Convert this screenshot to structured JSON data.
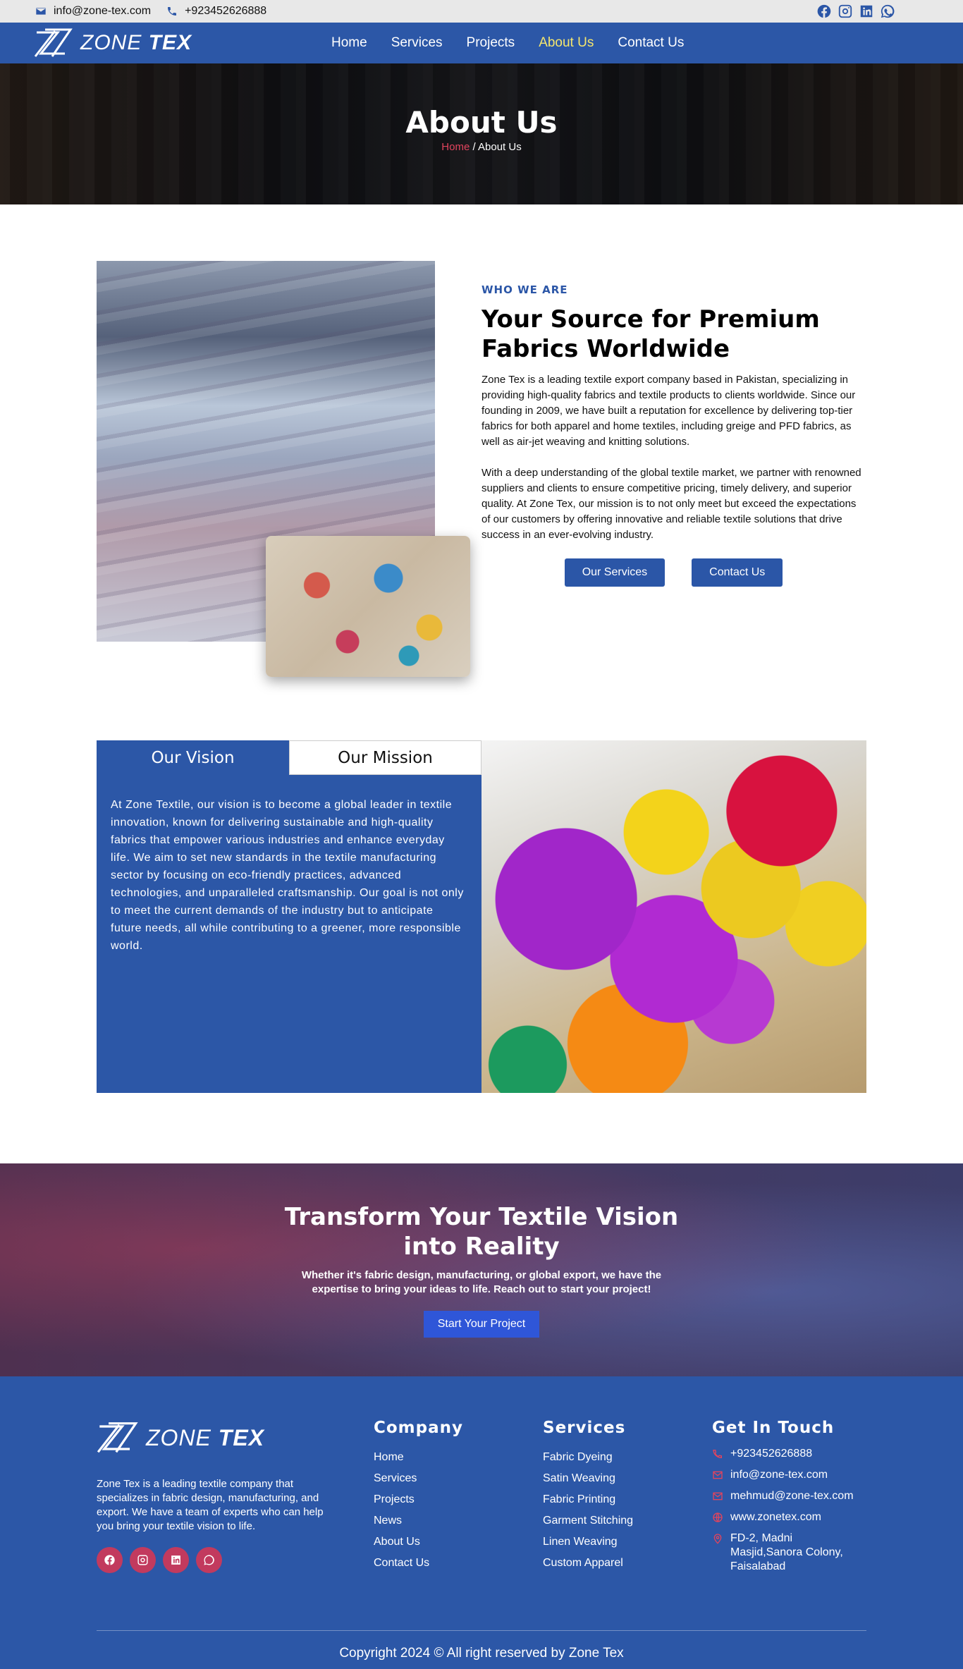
{
  "topbar": {
    "email": "info@zone-tex.com",
    "phone": "+923452626888",
    "social_icons": [
      "facebook-icon",
      "instagram-icon",
      "linkedin-icon",
      "whatsapp-icon"
    ]
  },
  "nav": {
    "logo_light": "ZONE",
    "logo_bold": "TEX",
    "items": [
      {
        "label": "Home"
      },
      {
        "label": "Services"
      },
      {
        "label": "Projects"
      },
      {
        "label": "About Us",
        "active": true
      },
      {
        "label": "Contact Us"
      }
    ]
  },
  "hero": {
    "title": "About Us",
    "crumb_home": "Home",
    "crumb_sep": " / ",
    "crumb_current": "About Us"
  },
  "about": {
    "eyebrow": "WHO WE ARE",
    "heading": "Your Source for Premium Fabrics Worldwide",
    "para1": "Zone Tex is a leading textile export company based in Pakistan, specializing in providing high-quality fabrics and textile products to clients worldwide. Since our founding in 2009, we have built a reputation for excellence by delivering top-tier fabrics for both apparel and home textiles, including greige and PFD fabrics, as well as air-jet weaving and knitting solutions.",
    "para2": "With a deep understanding of the global textile market, we partner with renowned suppliers and clients to ensure competitive pricing, timely delivery, and superior quality. At Zone Tex, our mission is to not only meet but exceed the expectations of our customers by offering innovative and reliable textile solutions that drive success in an ever-evolving industry.",
    "btn_services": "Our Services",
    "btn_contact": "Contact Us"
  },
  "vision": {
    "tab_vision": "Our Vision",
    "tab_mission": "Our Mission",
    "text": "At Zone Textile, our vision is to become a global leader in textile innovation, known for delivering sustainable and high-quality fabrics that empower various industries and enhance everyday life. We aim to set new standards in the textile manufacturing sector by focusing on eco-friendly practices, advanced technologies, and unparalleled craftsmanship. Our goal is not only to meet the current demands of the industry but to anticipate future needs, all while contributing to a greener, more responsible world."
  },
  "cta": {
    "heading": "Transform Your Textile Vision into Reality",
    "text": "Whether it's fabric design, manufacturing, or global export, we have the expertise to bring your ideas to life. Reach out to start your project!",
    "button": "Start Your Project"
  },
  "footer": {
    "logo_light": "ZONE",
    "logo_bold": "TEX",
    "description": "Zone Tex is a leading textile company that specializes in fabric design, manufacturing, and export. We have a team of experts who can help you bring your textile vision to life.",
    "company_title": "Company",
    "company_links": [
      "Home",
      "Services",
      "Projects",
      "News",
      "About Us",
      "Contact Us"
    ],
    "services_title": "Services",
    "services_links": [
      "Fabric Dyeing",
      "Satin Weaving",
      "Fabric Printing",
      "Garment Stitching",
      "Linen Weaving",
      "Custom Apparel"
    ],
    "contact_title": "Get In Touch",
    "phone": "+923452626888",
    "email1": "info@zone-tex.com",
    "email2": "mehmud@zone-tex.com",
    "website": "www.zonetex.com",
    "address": "FD-2, Madni Masjid,Sanora Colony, Faisalabad",
    "copyright": "Copyright 2024 © All right reserved by Zone Tex"
  },
  "colors": {
    "brand_blue": "#2c57a7",
    "active_nav": "#f5e66d",
    "accent_red": "#e2445d",
    "social_bg": "#c23a5e"
  }
}
